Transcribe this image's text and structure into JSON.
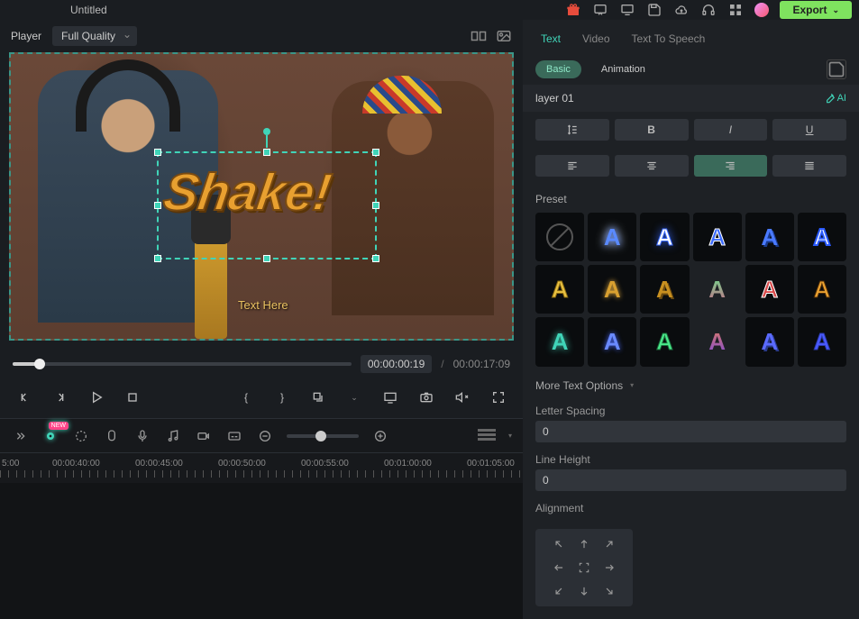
{
  "topbar": {
    "title": "Untitled",
    "export": "Export"
  },
  "player": {
    "label": "Player",
    "quality": "Full Quality",
    "overlay_text": "Shake!",
    "placeholder_text": "Text Here",
    "current": "00:00:00:19",
    "sep": "/",
    "total": "00:00:17:09"
  },
  "ruler": [
    "5:00",
    "00:00:40:00",
    "00:00:45:00",
    "00:00:50:00",
    "00:00:55:00",
    "00:01:00:00",
    "00:01:05:00"
  ],
  "tabs": {
    "text": "Text",
    "video": "Video",
    "tts": "Text To Speech"
  },
  "subtabs": {
    "basic": "Basic",
    "animation": "Animation"
  },
  "layer": "layer 01",
  "aiLabel": "AI",
  "format": {
    "bold": "B",
    "italic": "I",
    "underline": "U"
  },
  "preset_label": "Preset",
  "presets": [
    {
      "c": "",
      "cls": "none"
    },
    {
      "c": "A",
      "style": "color:#5a8aff;text-shadow:0 0 8px #5a8aff,0 0 12px #fff;"
    },
    {
      "c": "A",
      "style": "color:#fff;text-shadow:0 0 10px #3a6aff;-webkit-text-stroke:1px #3a6aff;"
    },
    {
      "c": "A",
      "style": "color:#3a6aff;-webkit-text-stroke:1px #fff;"
    },
    {
      "c": "A",
      "style": "color:#4a7aff;text-shadow:2px 2px 0 #1a3a8a;"
    },
    {
      "c": "A",
      "style": "color:#fff;-webkit-text-stroke:2px #2a5aff;"
    },
    {
      "c": "A",
      "style": "color:#e8c040;-webkit-text-stroke:1px #8a6a10;"
    },
    {
      "c": "A",
      "style": "color:#d8a030;text-shadow:0 0 6px #e8b040;"
    },
    {
      "c": "A",
      "style": "color:#c89020;text-shadow:2px 2px 0 #6a4a10;"
    },
    {
      "c": "A",
      "style": "background:linear-gradient(#4aff8a,#e84a8a);-webkit-background-clip:text;-webkit-text-fill-color:transparent;"
    },
    {
      "c": "A",
      "style": "color:#d84a4a;-webkit-text-stroke:1px #fff;"
    },
    {
      "c": "A",
      "style": "color:#e8a030;-webkit-text-stroke:1px #4a2a08;"
    },
    {
      "c": "A",
      "style": "color:#40d4b8;text-shadow:0 0 8px #40d4b8;"
    },
    {
      "c": "A",
      "style": "color:#6a8aff;text-shadow:0 0 6px #4a6aff;"
    },
    {
      "c": "A",
      "style": "color:#4ae88a;-webkit-text-stroke:1px #1a6a3a;"
    },
    {
      "c": "A",
      "style": "background:linear-gradient(#ff8a3a,#5a3aff);-webkit-background-clip:text;-webkit-text-fill-color:transparent;"
    },
    {
      "c": "A",
      "style": "color:#5a6aff;text-shadow:2px 2px 0 #2a3a8a;"
    },
    {
      "c": "A",
      "style": "color:#4a5aff;-webkit-text-stroke:1px #2a3aaa;"
    }
  ],
  "more": "More Text Options",
  "letterSpacing": {
    "label": "Letter Spacing",
    "value": "0"
  },
  "lineHeight": {
    "label": "Line Height",
    "value": "0"
  },
  "alignment": "Alignment"
}
